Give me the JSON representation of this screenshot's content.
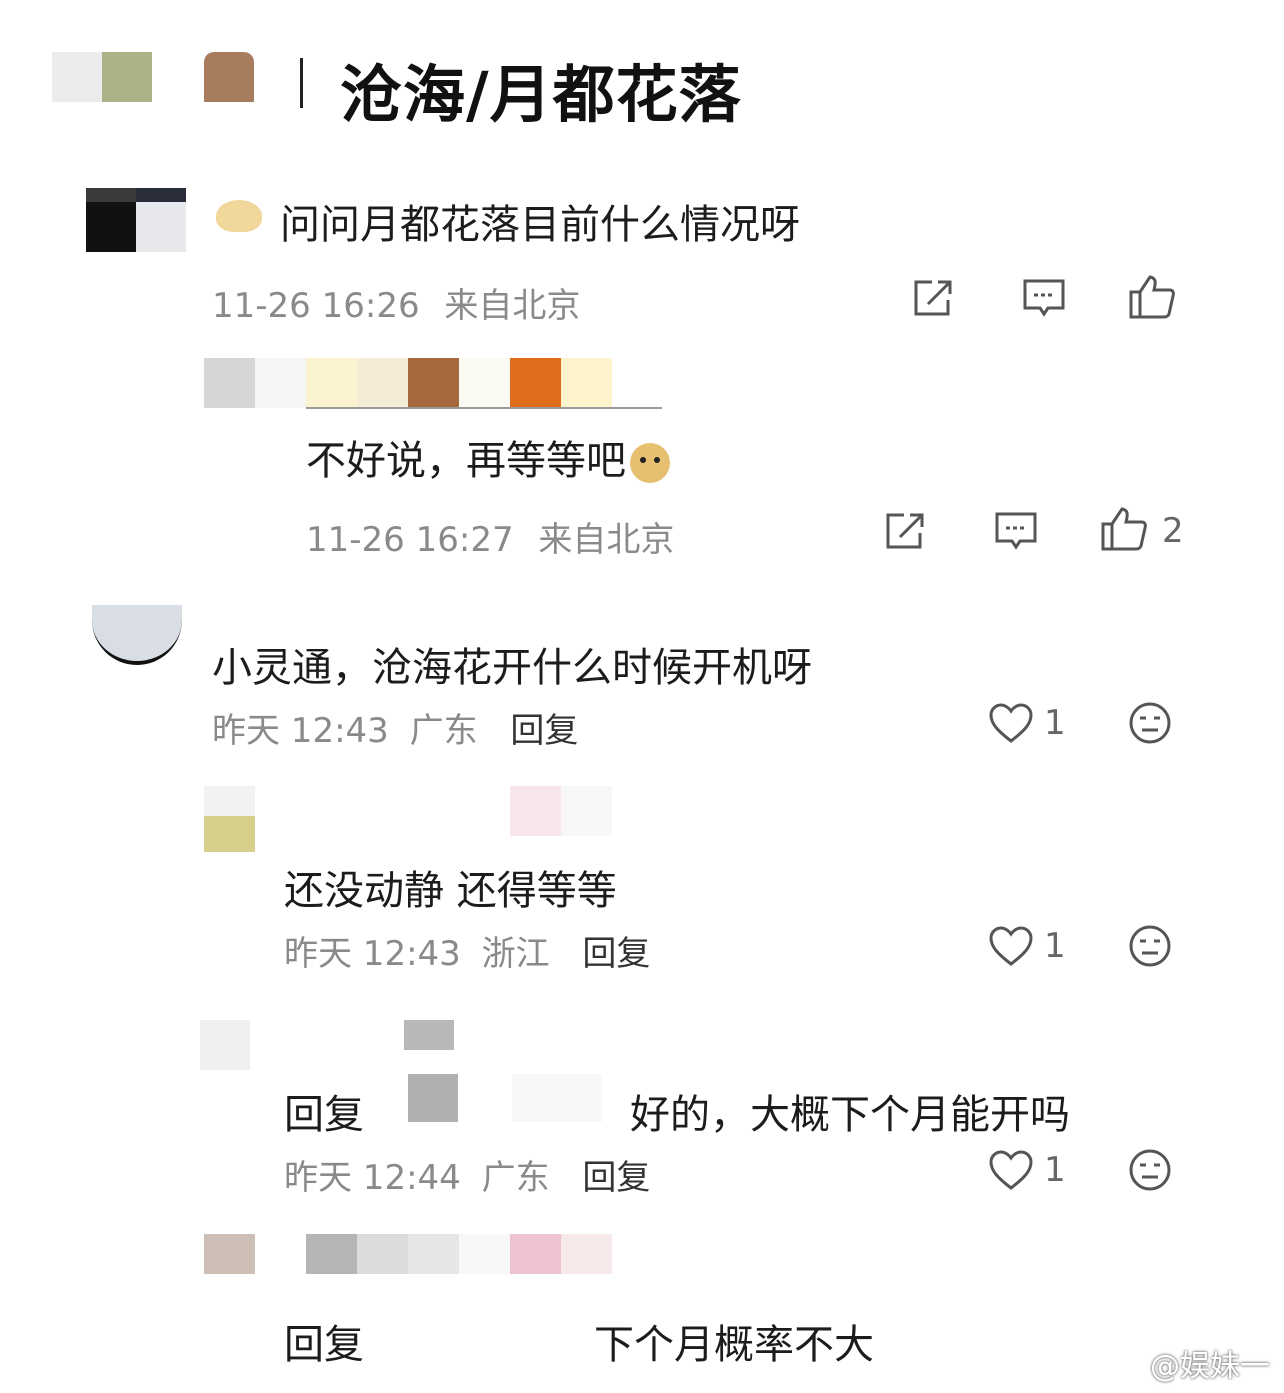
{
  "header": {
    "title": "沧海/月都花落"
  },
  "comments": [
    {
      "text": "问问月都花落目前什么情况呀",
      "time": "11-26 16:26",
      "location": "来自北京",
      "like_count": ""
    },
    {
      "text": "不好说，再等等吧",
      "time": "11-26 16:27",
      "location": "来自北京",
      "like_count": "2"
    }
  ],
  "thread": [
    {
      "text": "小灵通，沧海花开什么时候开机呀",
      "time": "昨天 12:43",
      "location": "广东",
      "reply_label": "回复",
      "like_count": "1"
    },
    {
      "text": "还没动静 还得等等",
      "time": "昨天 12:43",
      "location": "浙江",
      "reply_label": "回复",
      "like_count": "1"
    },
    {
      "reply_prefix": "回复",
      "text": "好的，大概下个月能开吗",
      "time": "昨天 12:44",
      "location": "广东",
      "reply_label": "回复",
      "like_count": "1"
    },
    {
      "reply_prefix": "回复",
      "text": "下个月概率不大"
    }
  ],
  "watermark": "@娱妹一",
  "colors": {
    "text": "#1c1c1c",
    "meta": "#8a8a8a",
    "icon": "#555555"
  },
  "icons": [
    "share-icon",
    "comment-icon",
    "thumbs-up-icon",
    "heart-icon",
    "neutral-face-icon"
  ]
}
